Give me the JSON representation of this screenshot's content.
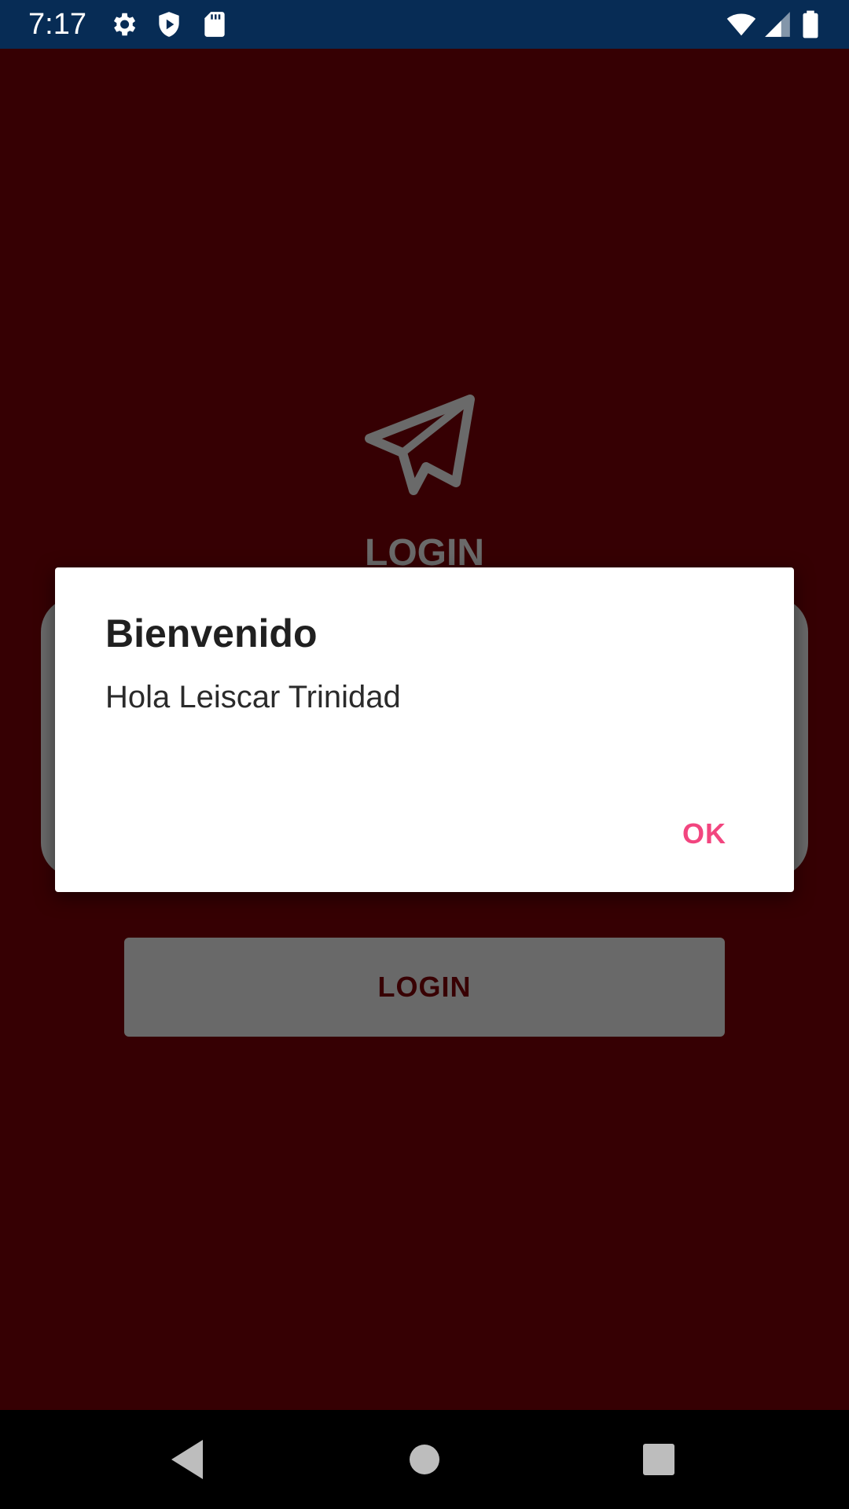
{
  "status_bar": {
    "time": "7:17",
    "icons": [
      "gear-icon",
      "shield-play-icon",
      "sd-card-icon",
      "wifi-icon",
      "signal-icon",
      "battery-icon"
    ]
  },
  "app": {
    "logo_icon": "paper-plane-icon",
    "title": "LOGIN",
    "login_button_label": "LOGIN"
  },
  "dialog": {
    "title": "Bienvenido",
    "message": "Hola Leiscar Trinidad",
    "ok_label": "OK"
  },
  "nav_bar": {
    "buttons": [
      "back-icon",
      "home-icon",
      "recents-icon"
    ]
  },
  "colors": {
    "background": "#360003",
    "status_bar": "#072c55",
    "accent": "#f2457f",
    "dimmed_gray": "#6a6a6a"
  }
}
